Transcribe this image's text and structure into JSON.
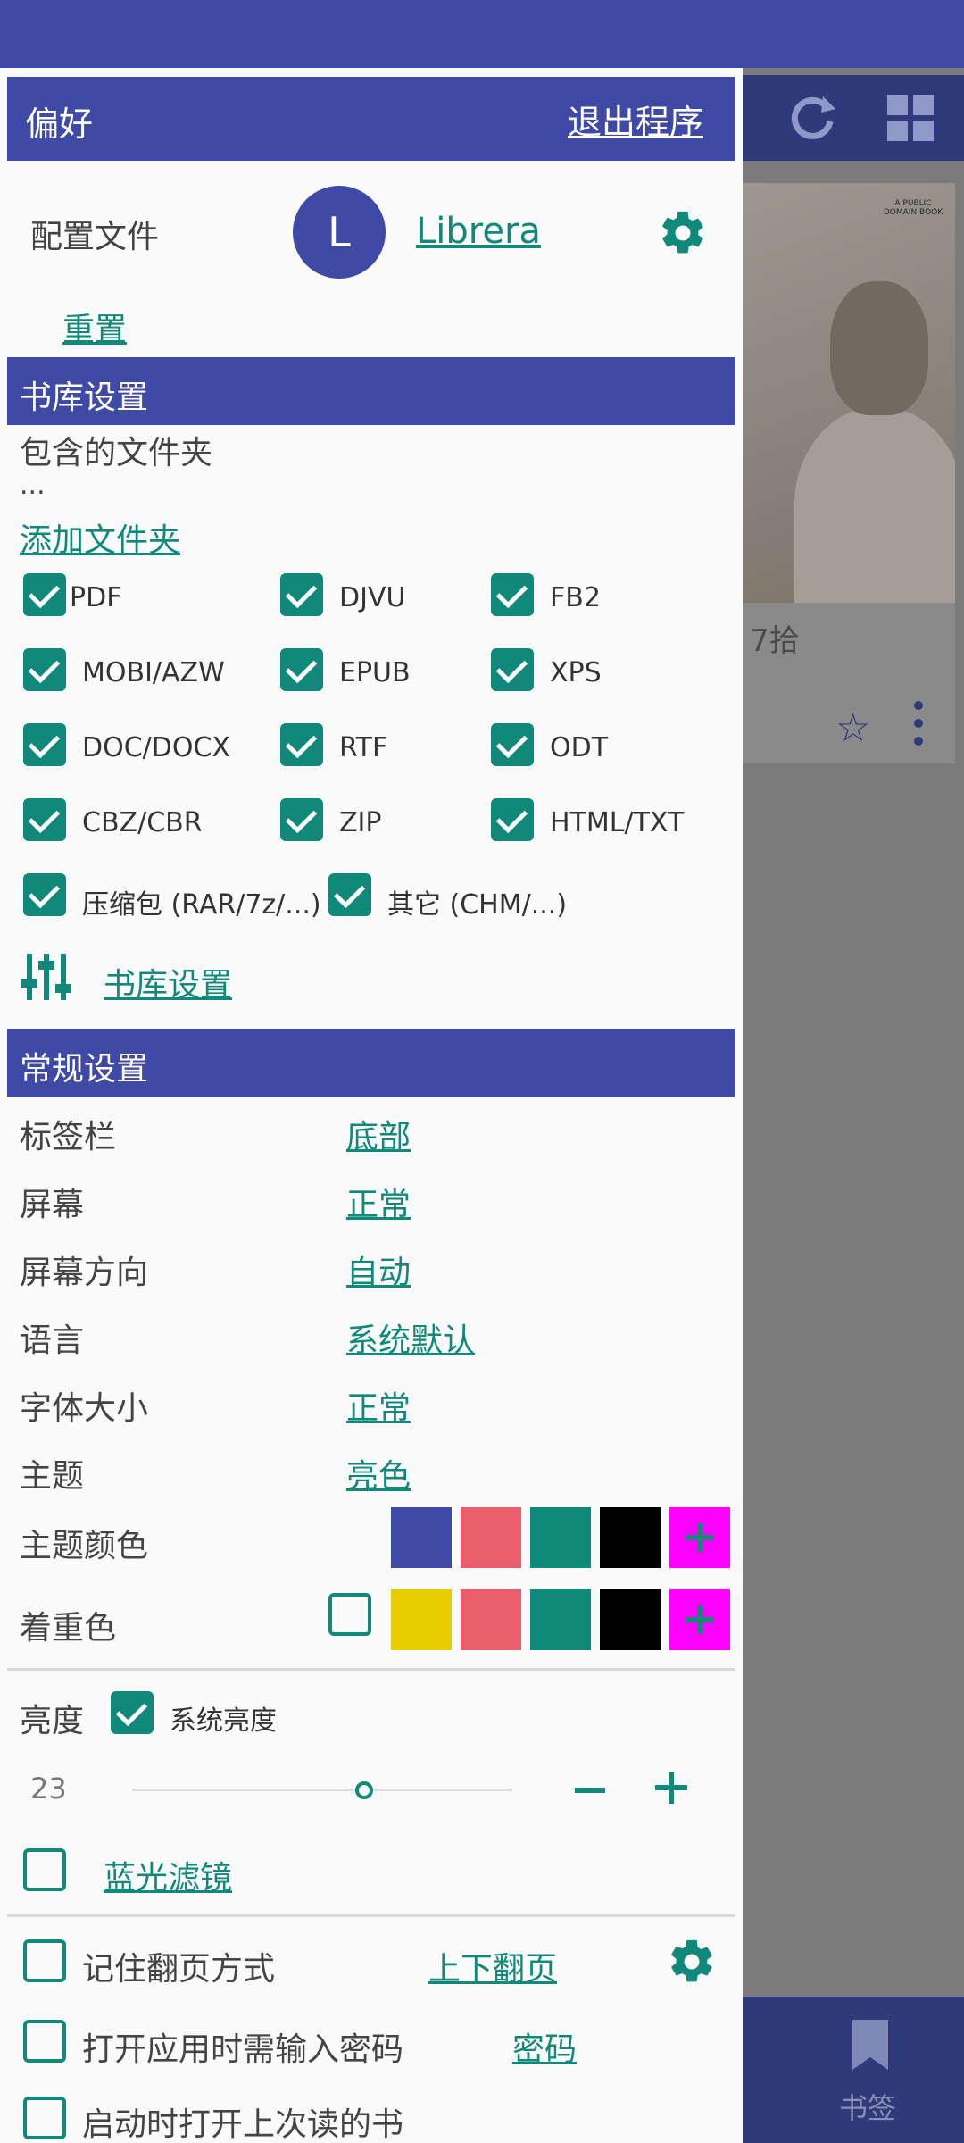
{
  "background": {
    "book_title_fragment": "7拾",
    "cover_text": "A PUBLIC DOMAIN BOOK",
    "bottom_tab_label": "书签"
  },
  "drawer": {
    "title": "偏好",
    "exit_label": "退出程序",
    "profile": {
      "label": "配置文件",
      "avatar_letter": "L",
      "name": "Librera",
      "reset_label": "重置"
    },
    "library": {
      "header": "书库设置",
      "folders_label": "包含的文件夹",
      "folders_value": "...",
      "add_folder": "添加文件夹",
      "formats": [
        {
          "label": "PDF",
          "checked": true
        },
        {
          "label": "DJVU",
          "checked": true
        },
        {
          "label": "FB2",
          "checked": true
        },
        {
          "label": "MOBI/AZW",
          "checked": true
        },
        {
          "label": "EPUB",
          "checked": true
        },
        {
          "label": "XPS",
          "checked": true
        },
        {
          "label": "DOC/DOCX",
          "checked": true
        },
        {
          "label": "RTF",
          "checked": true
        },
        {
          "label": "ODT",
          "checked": true
        },
        {
          "label": "CBZ/CBR",
          "checked": true
        },
        {
          "label": "ZIP",
          "checked": true
        },
        {
          "label": "HTML/TXT",
          "checked": true
        },
        {
          "label": "压缩包 (RAR/7z/...)",
          "checked": true
        },
        {
          "label": "其它 (CHM/...)",
          "checked": true
        }
      ],
      "settings_link": "书库设置"
    },
    "general": {
      "header": "常规设置",
      "rows": [
        {
          "label": "标签栏",
          "value": "底部"
        },
        {
          "label": "屏幕",
          "value": "正常"
        },
        {
          "label": "屏幕方向",
          "value": "自动"
        },
        {
          "label": "语言",
          "value": "系统默认"
        },
        {
          "label": "字体大小",
          "value": "正常"
        },
        {
          "label": "主题",
          "value": "亮色"
        }
      ],
      "theme_color_label": "主题颜色",
      "theme_colors": [
        "#3f4aa6",
        "#ea5d6b",
        "#0f8a7a",
        "#000000",
        "#ff00ff"
      ],
      "accent_color_label": "着重色",
      "accent_colors": [
        "#e6cc00",
        "#ea5d6b",
        "#0f8a7a",
        "#000000",
        "#ff00ff"
      ],
      "brightness_label": "亮度",
      "system_brightness_label": "系统亮度",
      "brightness_value": "23",
      "brightness_fraction": 0.6,
      "blue_filter_label": "蓝光滤镜",
      "remember_page_label": "记住翻页方式",
      "page_mode_value": "上下翻页",
      "password_label": "打开应用时需输入密码",
      "password_link": "密码",
      "open_last_label": "启动时打开上次读的书"
    }
  }
}
